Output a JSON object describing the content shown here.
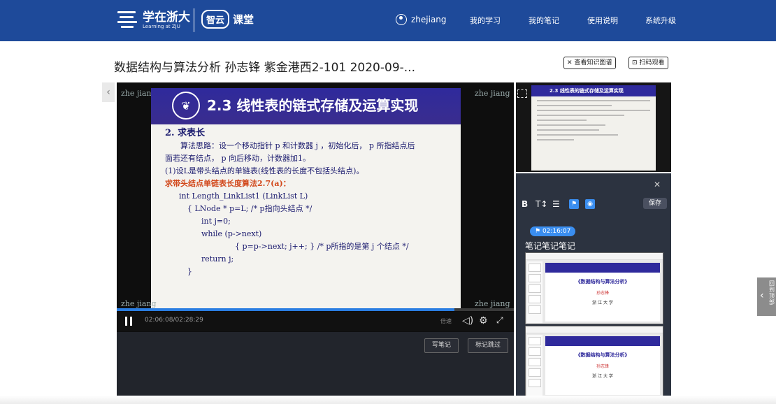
{
  "header": {
    "logo_cn": "学在浙大",
    "logo_en": "Learning at ZJU",
    "zhiyun": "智云",
    "ketang": "课堂",
    "username": "zhejiang",
    "nav": [
      "我的学习",
      "我的笔记",
      "使用说明",
      "系统升级"
    ]
  },
  "page": {
    "title": "数据结构与算法分析 孙志锋 紫金港西2-101 2020-09-...",
    "knowledge_btn": "查看知识图谱",
    "scan_btn": "扫码观看"
  },
  "slide": {
    "heading": "2.3  线性表的链式存储及运算实现",
    "watermark": "zhe jiang",
    "lines": [
      "2. 求表长",
      "算法思路：设一个移动指针 p 和计数器 j ，初始化后， p 所指结点后",
      "面若还有结点， p 向后移动，计数器加1。",
      "(1)设L是带头结点的单链表(线性表的长度不包括头结点)。",
      "求带头结点单链表长度算法2.7(a)：",
      "int  Length_LinkList1 (LinkList L)",
      "{ LNode  * p=L;        /* p指向头结点 */",
      "int   j=0;",
      "while  (p->next)",
      "{ p=p->next;  j++; }    /* p所指的是第  j  个结点 */",
      "return   j;",
      "}"
    ]
  },
  "player": {
    "time": "02:06:08/02:28:29",
    "speed": "倍速",
    "progress": 0.85,
    "write_note": "写笔记",
    "mark_skip": "标记跳过"
  },
  "thumb": {
    "heading": "2.3 线性表的链式存储及运算实现"
  },
  "notes": {
    "toolbar": [
      "B",
      "T↕",
      "☰"
    ],
    "save": "保存",
    "timestamp": "02:16:07",
    "text": "笔记笔记笔记",
    "shot_title": "《数据结构与算法分析》",
    "shot_author": "孙志锋",
    "shot_school": "浙 江 大 学"
  },
  "side_tab": "回到顶部"
}
